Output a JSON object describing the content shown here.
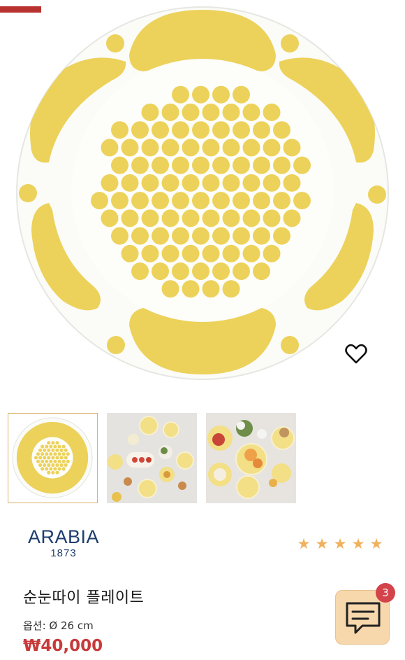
{
  "product": {
    "brand_name": "ARABIA",
    "brand_year": "1873",
    "rating_stars": 5,
    "title": "순눈따이 플레이트",
    "option_text": "옵션: Ø 26 cm",
    "price": "₩40,000"
  },
  "gallery": {
    "thumbnail_count": 3,
    "selected_index": 0
  },
  "chat": {
    "unread_count": "3"
  },
  "colors": {
    "accent": "#b8322f",
    "brand": "#1e3c6e",
    "price": "#c83a3a",
    "star": "#f0b15c",
    "plate_yellow": "#ecd25a",
    "chat_bg": "#f7d8ad",
    "badge": "#d4424a"
  },
  "icons": {
    "wishlist": "heart-outline-icon",
    "chat": "chat-bubble-icon",
    "rating": "star-icon"
  }
}
